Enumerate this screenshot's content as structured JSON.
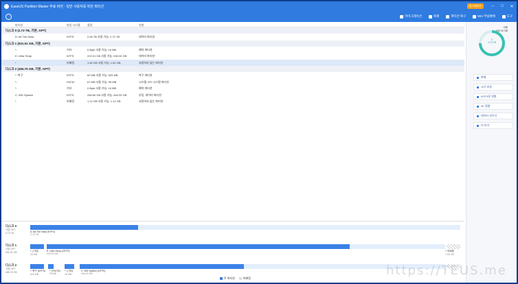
{
  "titlebar": {
    "title": "EaseUS Partition Master 무료 버전 - 일반 사용자를 위한 파티션",
    "upgrade": "업그레이드"
  },
  "toolbar": {
    "items": [
      "마이그레이션",
      "복제",
      "파티션 복구",
      "Win 부팅매체",
      "도구"
    ]
  },
  "table": {
    "headers": [
      "파티션",
      "파일 시스템",
      "용량",
      "유형"
    ],
    "disks": [
      {
        "title": "디스크 0 (2.73 TB, 기본, GPT)",
        "rows": [
          {
            "name": "D: All The Data",
            "fs": "NTFS",
            "cap": "2.06 TB   사용 가능: 2.72 TB",
            "type": "데이터 파티션"
          }
        ]
      },
      {
        "title": "디스크 1 (931.51 GB, 기본, GPT)",
        "rows": [
          {
            "name": "*:",
            "fs": "기타",
            "cap": "0 Byte   사용 가능: 16 MB",
            "type": "예약 파티션"
          },
          {
            "name": "E: Ultra Temp",
            "fs": "NTFS",
            "cap": "222.01 GB 사용 가능: 930.00 GB",
            "type": "데이터 파티션"
          },
          {
            "name": "*",
            "fs": "미배정",
            "cap": "1.50 GB 사용 가능: 1.50 GB",
            "type": "사용하지 않는 파티션"
          }
        ]
      },
      {
        "title": "디스크 2 (465.76 GB, 기본, GPT)",
        "rows": [
          {
            "name": "*: 복구",
            "fs": "NTFS",
            "cap": "62 MB   사용 가능: 529 MB",
            "type": "복구 파티션"
          },
          {
            "name": "*:",
            "fs": "FAT32",
            "cap": "67 MB   사용 가능: 99 MB",
            "type": "시스템, EFI 시스템 파티션"
          },
          {
            "name": "*:",
            "fs": "기타",
            "cap": "0 Byte   사용 가능: 16 MB",
            "type": "예약 파티션"
          },
          {
            "name": "C: WD System",
            "fs": "NTFS",
            "cap": "256.60 GB 사용 가능: 464.00 GB",
            "type": "부팅, 데이터 파티션"
          },
          {
            "name": "*",
            "fs": "미배정",
            "cap": "1.12 GB 사용 가능: 1.12 GB",
            "type": "사용하지 않는 파티션"
          }
        ]
      }
    ]
  },
  "maps": [
    {
      "name": "디스크 0",
      "kind": "기본 GPT",
      "size": "2.73 TB",
      "parts": [
        {
          "label": "D: All The Data (NTFS)",
          "size": "2.73 TB"
        }
      ]
    },
    {
      "name": "디스크 1",
      "kind": "기본 GPT",
      "size": "931.51 GB",
      "parts": [
        {
          "label": "*: (기타)",
          "size": "16 MB"
        },
        {
          "label": "E: Ultra Temp (NTFS)",
          "size": "930.00 GB"
        },
        {
          "label": "*: 미배정",
          "size": "1.50 GB"
        }
      ]
    },
    {
      "name": "디스크 2",
      "kind": "기본 GPT",
      "size": "465.76 GB",
      "parts": [
        {
          "label": "*: 복구 (NTFS)",
          "size": "529 MB"
        },
        {
          "label": "*: (FAT32)",
          "size": "99 MB"
        },
        {
          "label": "*: (기타)",
          "size": "16 MB"
        },
        {
          "label": "C: WD System (NTFS)",
          "size": "464.00 GB"
        },
        {
          "label": "*: 미배정",
          "size": "1.12 GB"
        }
      ]
    }
  ],
  "legend": {
    "primary": "주 파티션",
    "unalloc": "미배정"
  },
  "sidebar": {
    "donut_top": "사용",
    "donut_top_value": "930.00 GB",
    "donut_center": "0",
    "donut_center_sub": "2.73 TB",
    "actions": [
      "복제",
      "크기 조정",
      "NTFS로 변환",
      "4K 정렬",
      "데이터 지우기",
      "더 보기"
    ]
  },
  "watermark": "https://TEUS.me"
}
